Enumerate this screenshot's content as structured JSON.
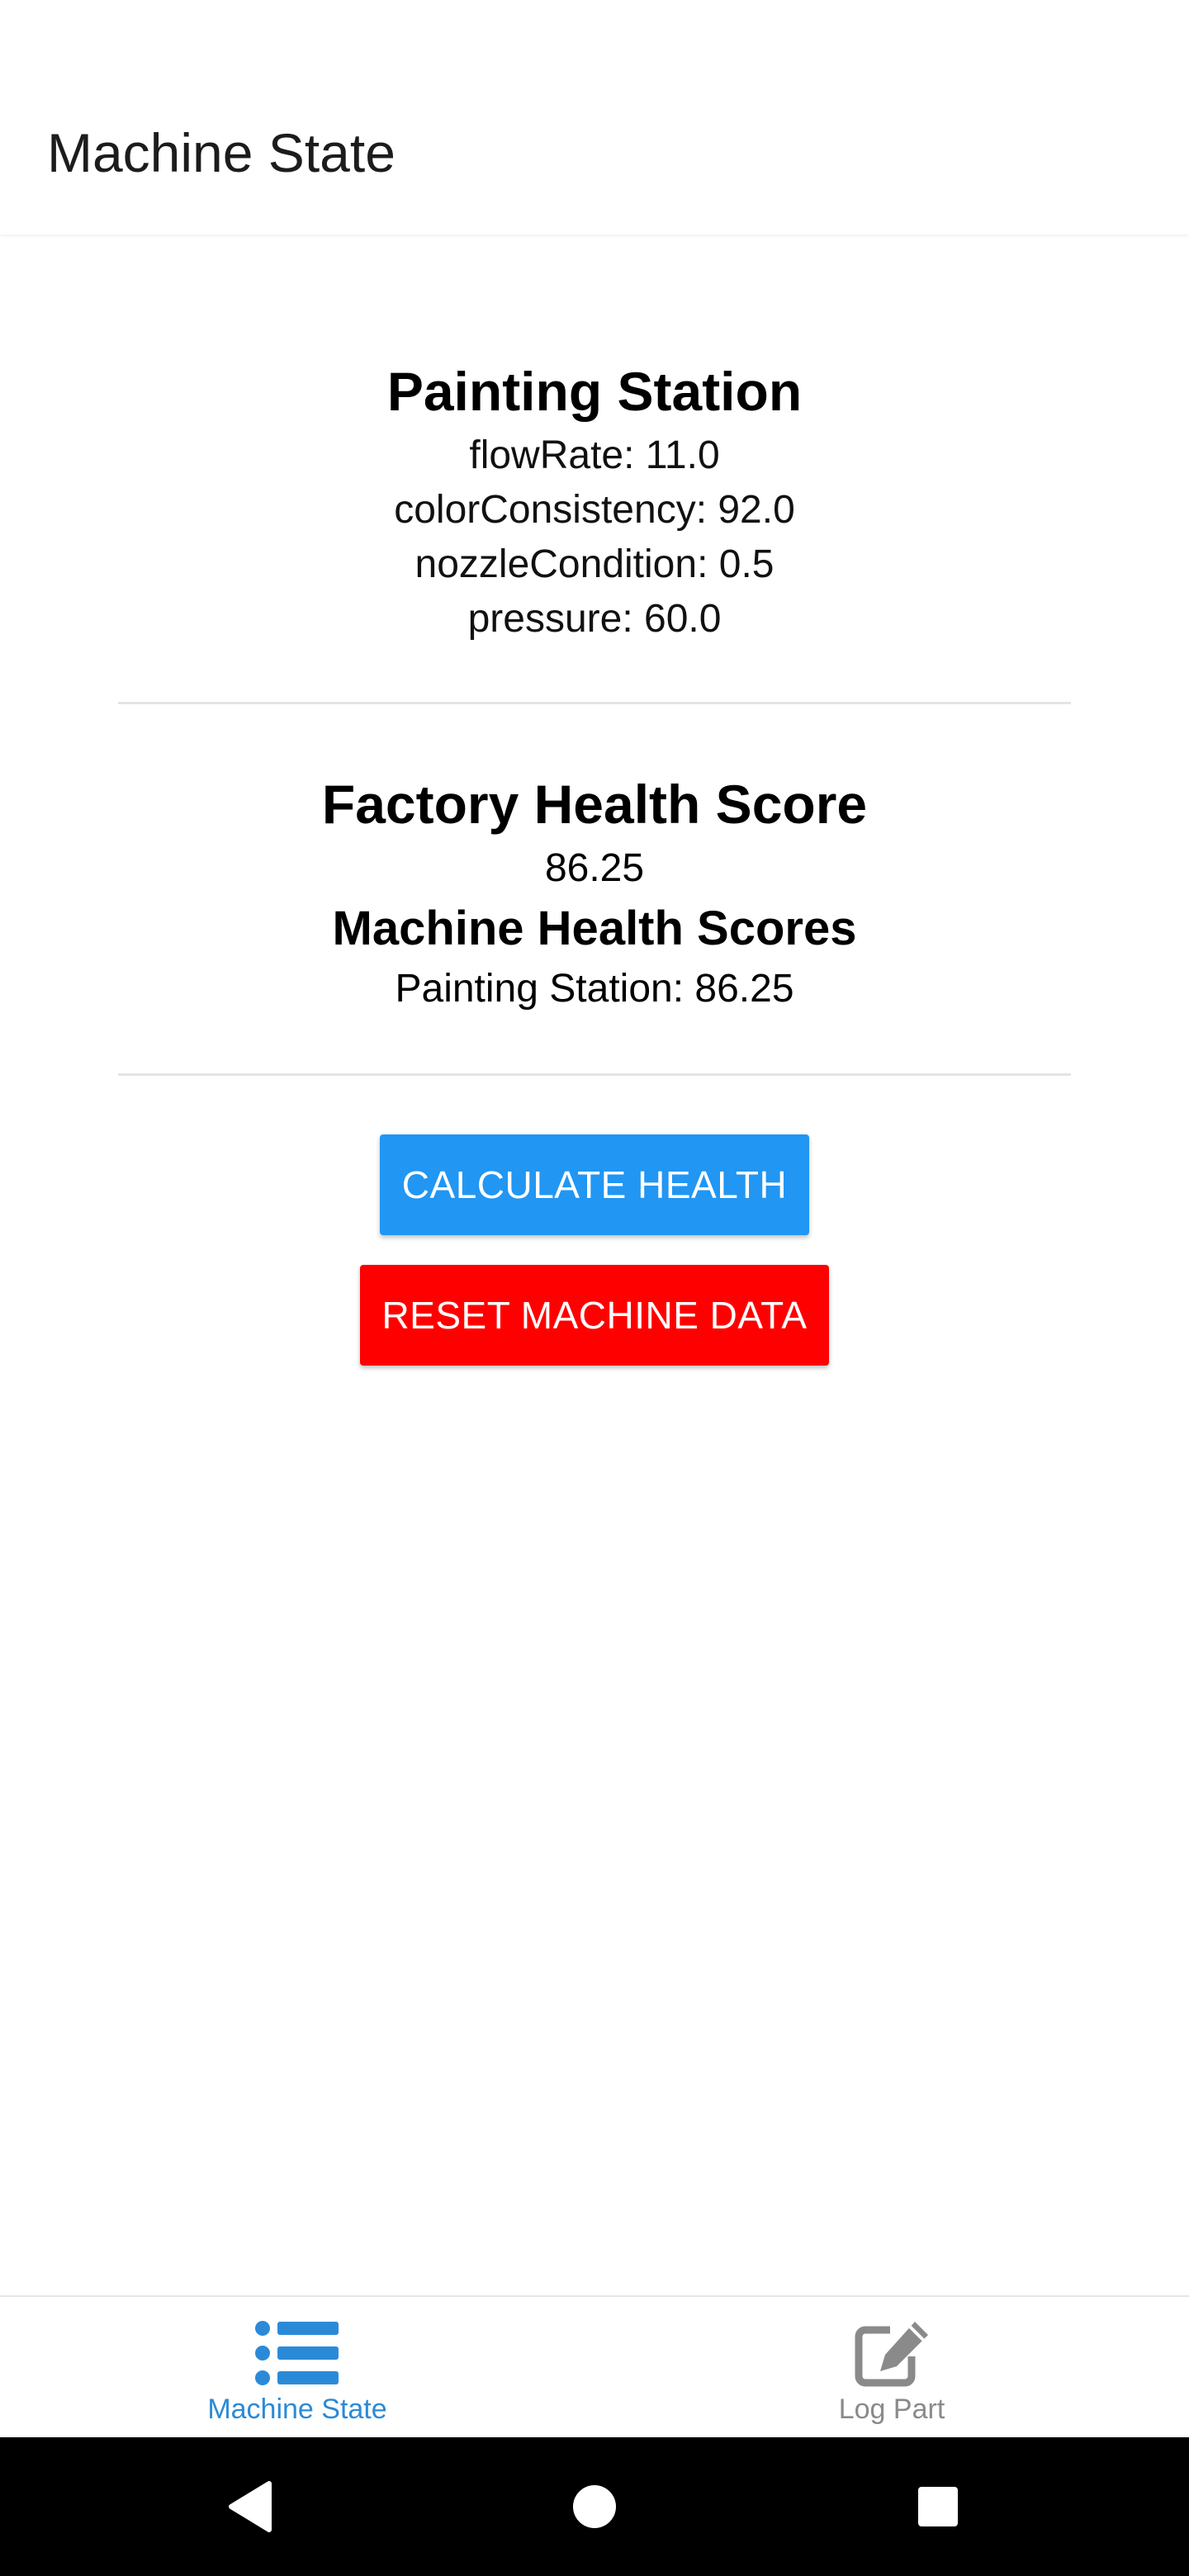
{
  "header": {
    "title": "Machine State"
  },
  "station": {
    "title": "Painting Station",
    "metrics": [
      "flowRate: 11.0",
      "colorConsistency: 92.0",
      "nozzleCondition: 0.5",
      "pressure: 60.0"
    ]
  },
  "factory_health": {
    "title": "Factory Health Score",
    "value": "86.25",
    "machine_scores_title": "Machine Health Scores",
    "machine_scores": [
      "Painting Station: 86.25"
    ]
  },
  "buttons": {
    "calculate_label": "CALCULATE HEALTH",
    "reset_label": "RESET MACHINE DATA"
  },
  "tabs": [
    {
      "label": "Machine State",
      "icon": "list-icon",
      "active": true
    },
    {
      "label": "Log Part",
      "icon": "edit-icon",
      "active": false
    }
  ],
  "colors": {
    "primary_button": "#2196f3",
    "danger_button": "#ff0000",
    "active_tab": "#2b8ad8",
    "inactive_tab": "#8a8a8a"
  }
}
